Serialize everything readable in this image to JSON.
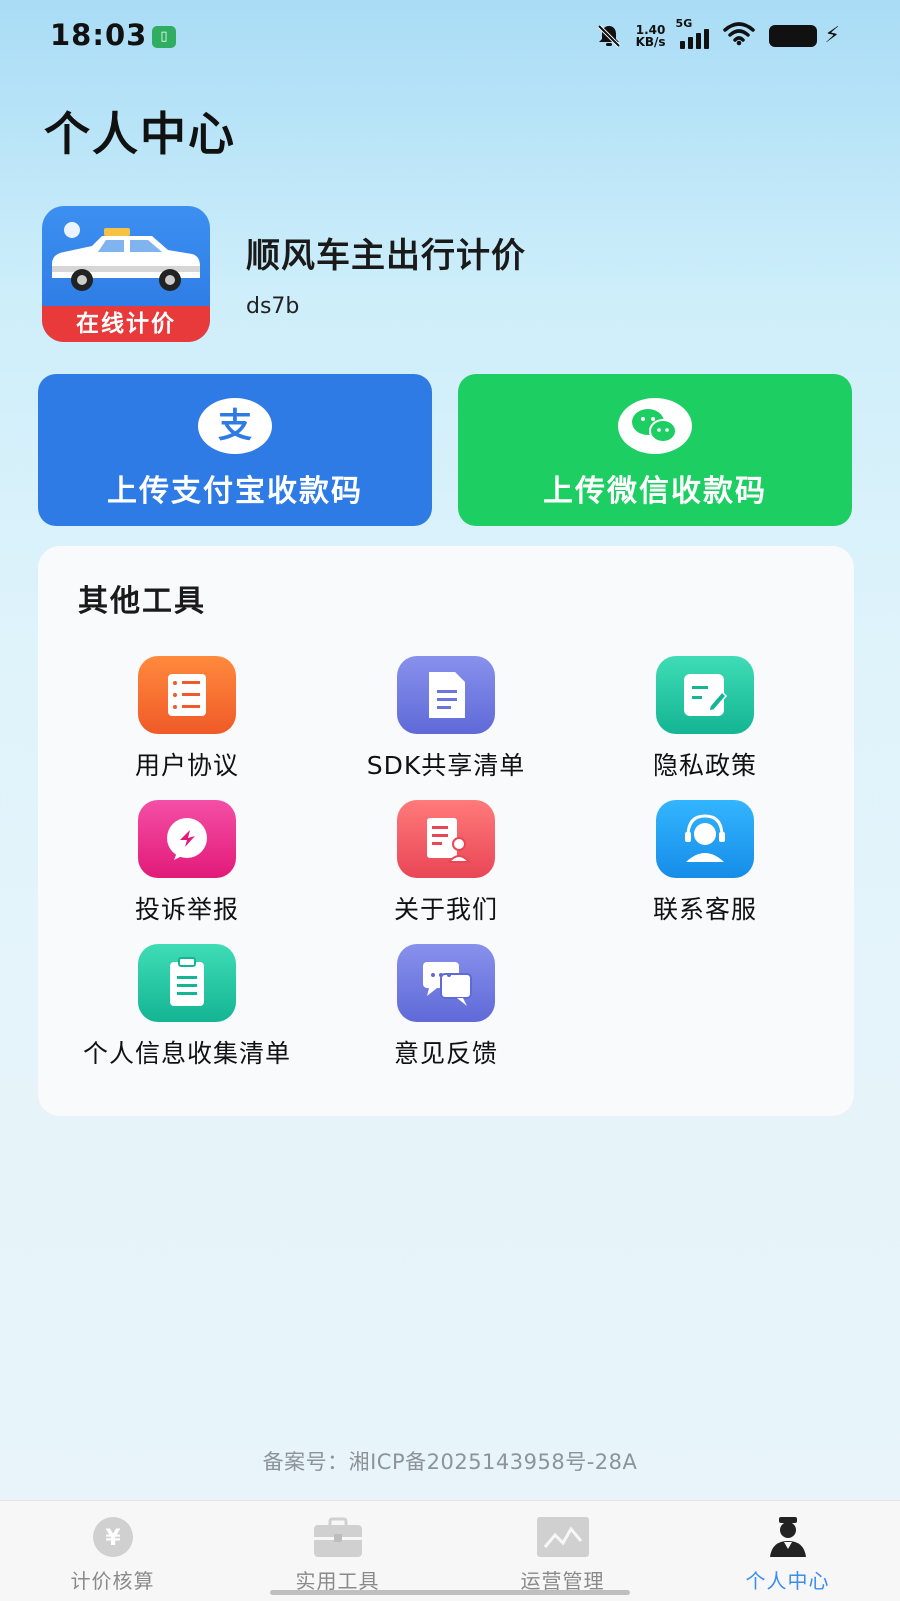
{
  "status_bar": {
    "time": "18:03",
    "net_speed_value": "1.40",
    "net_speed_unit": "KB/s",
    "network_type": "5G",
    "icons": [
      "sim-card-icon",
      "bell-off-icon",
      "signal-icon",
      "wifi-icon",
      "battery-icon",
      "charging-icon"
    ]
  },
  "header": {
    "title": "个人中心"
  },
  "app_info": {
    "name": "顺风车主出行计价",
    "code": "ds7b",
    "logo_banner": "在线计价"
  },
  "payment": {
    "alipay_label": "上传支付宝收款码",
    "alipay_icon_text": "支",
    "wechat_label": "上传微信收款码",
    "colors": {
      "alipay": "#2f7be6",
      "wechat": "#1dce62"
    }
  },
  "tools": {
    "title": "其他工具",
    "items": [
      {
        "label": "用户协议",
        "icon": "notebook-icon"
      },
      {
        "label": "SDK共享清单",
        "icon": "document-icon"
      },
      {
        "label": "隐私政策",
        "icon": "edit-note-icon"
      },
      {
        "label": "投诉举报",
        "icon": "complaint-icon"
      },
      {
        "label": "关于我们",
        "icon": "about-card-icon"
      },
      {
        "label": "联系客服",
        "icon": "headset-icon"
      },
      {
        "label": "个人信息收集清单",
        "icon": "clipboard-icon"
      },
      {
        "label": "意见反馈",
        "icon": "chat-bubbles-icon"
      }
    ]
  },
  "footer": {
    "icp": "备案号：湘ICP备2025143958号-28A"
  },
  "tabbar": {
    "items": [
      {
        "label": "计价核算",
        "icon": "yuan-coin-icon",
        "active": false
      },
      {
        "label": "实用工具",
        "icon": "toolbox-icon",
        "active": false
      },
      {
        "label": "运营管理",
        "icon": "chart-icon",
        "active": false
      },
      {
        "label": "个人中心",
        "icon": "driver-person-icon",
        "active": true
      }
    ],
    "active_color": "#3a8ef0"
  }
}
